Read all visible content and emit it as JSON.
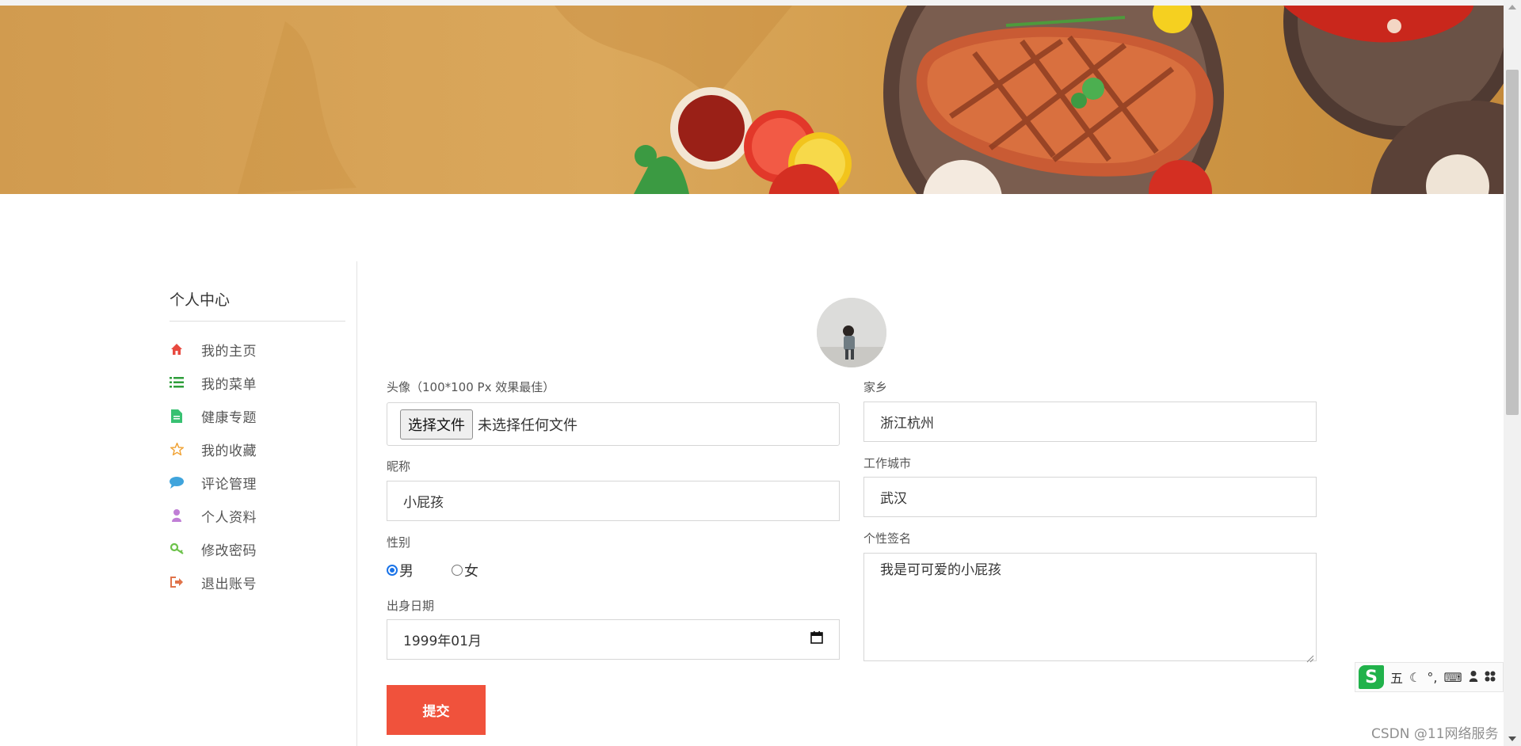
{
  "sidebar": {
    "title": "个人中心",
    "items": [
      {
        "label": "我的主页",
        "icon": "home-icon",
        "color": "#e8493f"
      },
      {
        "label": "我的菜单",
        "icon": "list-icon",
        "color": "#2e9e3a"
      },
      {
        "label": "健康专题",
        "icon": "file-icon",
        "color": "#38c172"
      },
      {
        "label": "我的收藏",
        "icon": "star-icon",
        "color": "#f0a030"
      },
      {
        "label": "评论管理",
        "icon": "comment-icon",
        "color": "#3fa4dc"
      },
      {
        "label": "个人资料",
        "icon": "user-icon",
        "color": "#c07ed6"
      },
      {
        "label": "修改密码",
        "icon": "key-icon",
        "color": "#6cc24a"
      },
      {
        "label": "退出账号",
        "icon": "logout-icon",
        "color": "#e0734a"
      }
    ]
  },
  "form": {
    "avatar_label": "头像（100*100 Px 效果最佳）",
    "file_button": "选择文件",
    "file_status": "未选择任何文件",
    "nickname_label": "昵称",
    "nickname_value": "小屁孩",
    "gender_label": "性别",
    "gender_options": [
      "男",
      "女"
    ],
    "gender_selected": "男",
    "birth_label": "出身日期",
    "birth_value": "1999年01月",
    "hometown_label": "家乡",
    "hometown_value": "浙江杭州",
    "workcity_label": "工作城市",
    "workcity_value": "武汉",
    "signature_label": "个性签名",
    "signature_value": "我是可可爱的小屁孩",
    "submit_label": "提交"
  },
  "ime": {
    "mode": "五"
  },
  "watermark": "CSDN @11网络服务",
  "colors": {
    "accent": "#f0523c",
    "radio": "#1a73e8",
    "banner": "#d4a052"
  }
}
